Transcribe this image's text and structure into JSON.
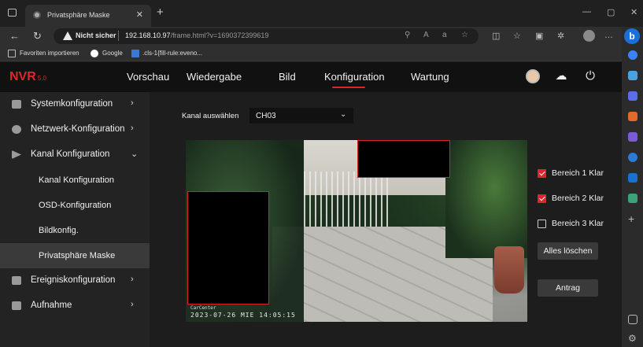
{
  "browser": {
    "tab_title": "Privatsphäre Maske",
    "tab_close": "✕",
    "new_tab": "+",
    "security_label": "Nicht sicher",
    "url_host": "192.168.10.97",
    "url_path": "/frame.html?v=1690372399619",
    "favorites": [
      {
        "label": "Favoriten importieren",
        "icon": "import-icon"
      },
      {
        "label": "Google",
        "icon": "google-icon"
      },
      {
        "label": ".cls-1{fill-rule:eveno...",
        "icon": "page-icon"
      }
    ]
  },
  "app": {
    "logo": "NVR",
    "logo_version": "5.0",
    "nav": [
      "Vorschau",
      "Wiedergabe",
      "Bild",
      "Konfiguration",
      "Wartung"
    ],
    "active_nav": "Konfiguration",
    "accent_color": "#e0242b"
  },
  "sidebar": {
    "items": [
      {
        "label": "Systemkonfiguration",
        "icon": "system-icon",
        "chevron": "›"
      },
      {
        "label": "Netzwerk-Konfiguration",
        "icon": "network-icon",
        "chevron": "›"
      },
      {
        "label": "Kanal Konfiguration",
        "icon": "channel-icon",
        "chevron": "⌄"
      },
      {
        "label": "Kanal Konfiguration",
        "sub": true
      },
      {
        "label": "OSD-Konfiguration",
        "sub": true
      },
      {
        "label": "Bildkonfig.",
        "sub": true
      },
      {
        "label": "Privatsphäre Maske",
        "sub": true,
        "active": true
      },
      {
        "label": "Ereigniskonfiguration",
        "icon": "event-icon",
        "chevron": "›"
      },
      {
        "label": "Aufnahme",
        "icon": "record-icon",
        "chevron": "›"
      }
    ]
  },
  "main": {
    "channel_label": "Kanal auswählen",
    "channel_value": "CH03",
    "areas": [
      {
        "label": "Bereich 1 Klar",
        "checked": true
      },
      {
        "label": "Bereich 2 Klar",
        "checked": true
      },
      {
        "label": "Bereich 3 Klar",
        "checked": false
      }
    ],
    "clear_all_label": "Alles löschen",
    "apply_label": "Antrag",
    "osd_camera_name": "CarCenter",
    "osd_timestamp": "2023-07-26 MIE 14:05:15"
  }
}
